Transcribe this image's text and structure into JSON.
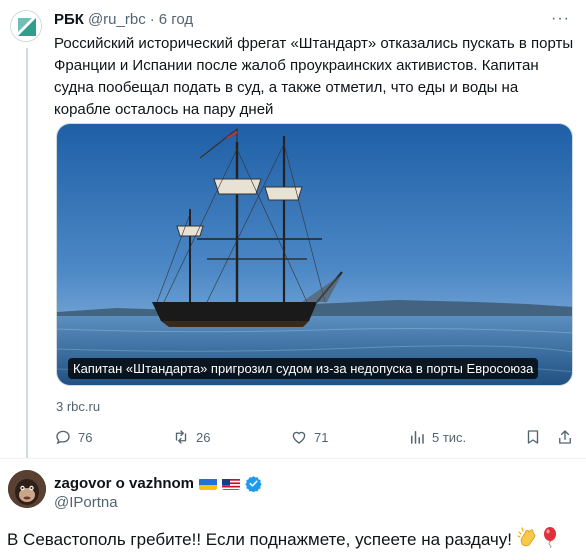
{
  "tweet": {
    "author_name": "РБК",
    "author_handle": "@ru_rbc",
    "separator": "·",
    "time": "6 год",
    "more": "···",
    "text": "Российский исторический фрегат «Штандарт» отказались пускать в порты Франции и Испании после жалоб проукраинских активистов. Капитан судна пообещал подать в суд, а также отметил, что еды и воды на корабле осталось на пару дней",
    "media_caption": "Капитан «Штандарта» пригрозил судом из-за недопуска в порты Евросоюза",
    "source": "3 rbc.ru",
    "actions": {
      "replies": "76",
      "retweets": "26",
      "likes": "71",
      "views": "5 тис."
    },
    "icons": [
      "reply-icon",
      "retweet-icon",
      "like-icon",
      "views-icon",
      "bookmark-icon",
      "share-icon"
    ]
  },
  "reply": {
    "author_name": "zagovor o vazhnom",
    "author_handle": "@IPortna",
    "text": "В Севастополь гребите!! Если поднажмете, успеете на раздачу!",
    "emojis": [
      "clapping-hands-emoji",
      "balloon-emoji"
    ]
  },
  "colors": {
    "text": "#0f1419",
    "secondary": "#536471",
    "verified": "#1d9bf0",
    "rbc_green": "#2e9e8f"
  }
}
